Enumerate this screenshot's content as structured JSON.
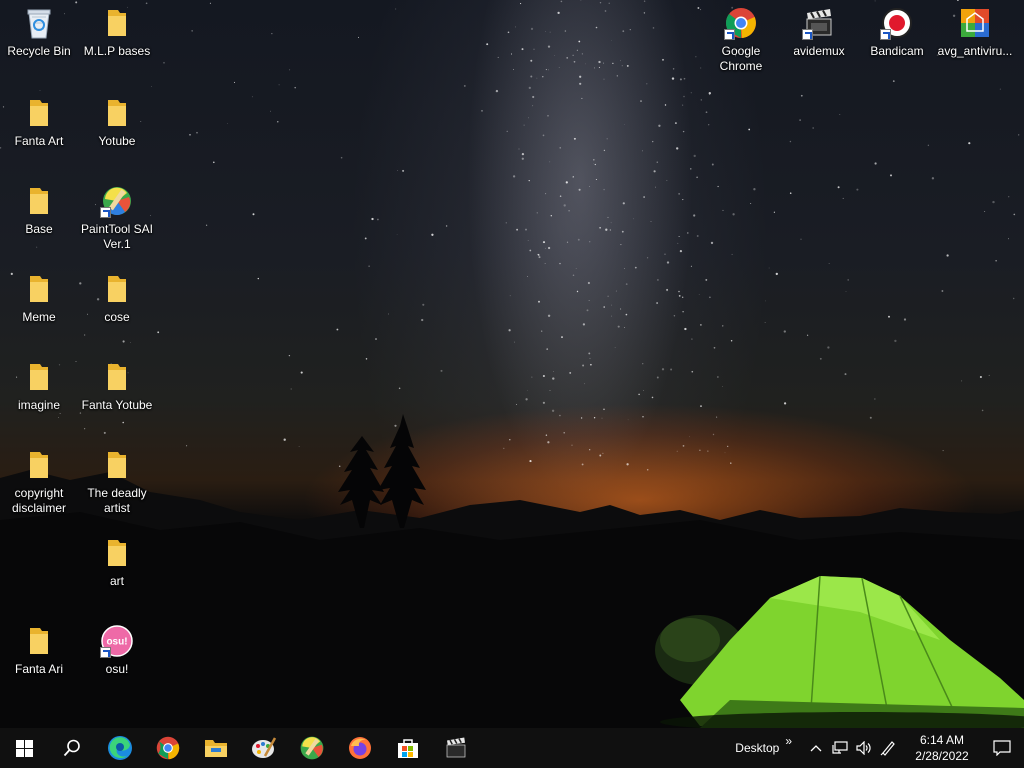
{
  "desktop": {
    "icons": {
      "recycle_bin": "Recycle Bin",
      "mlp_bases": "M.L.P bases",
      "fanta_art": "Fanta Art",
      "yotube": "Yotube",
      "base": "Base",
      "painttool_sai": "PaintTool SAI Ver.1",
      "meme": "Meme",
      "cose": "cose",
      "imagine": "imagine",
      "fanta_yotube": "Fanta Yotube",
      "copyright_disclaimer": "copyright disclaimer",
      "the_deadly_artist": "The deadly artist",
      "art": "art",
      "fanta_ari": "Fanta Ari",
      "osu": "osu!",
      "google_chrome": "Google Chrome",
      "avidemux": "avidemux",
      "bandicam": "Bandicam",
      "avg_antivirus": "avg_antiviru..."
    },
    "osu_badge": "osu!"
  },
  "taskbar": {
    "pinned": [
      "windows-start",
      "search",
      "microsoft-edge",
      "google-chrome",
      "file-explorer",
      "paint-palette",
      "painttool-sai",
      "firefox",
      "microsoft-store",
      "avidemux"
    ],
    "tray": {
      "desktop_label": "Desktop",
      "chevron": "»",
      "time": "6:14 AM",
      "date": "2/28/2022"
    }
  },
  "colors": {
    "taskbar_bg": "#101010",
    "folder_yellow": "#f5c542",
    "tent_green": "#8ee03a"
  }
}
